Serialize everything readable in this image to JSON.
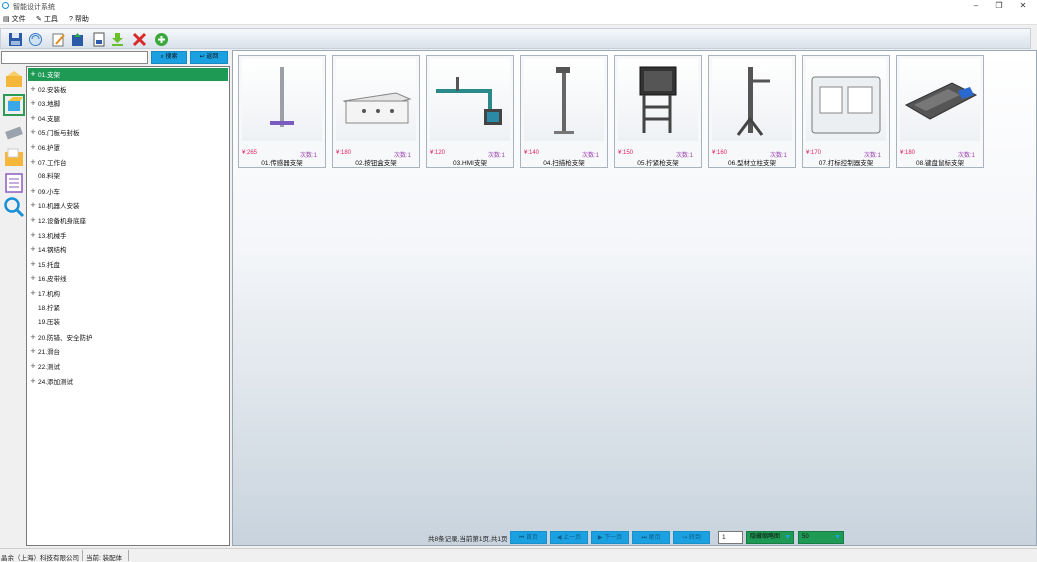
{
  "window": {
    "title": "智能设计系统",
    "minimize": "–",
    "restore": "❐",
    "close": "✕"
  },
  "menu": [
    {
      "label": "文件",
      "icon": "file-icon"
    },
    {
      "label": "工具",
      "icon": "wrench-icon"
    },
    {
      "label": "帮助",
      "icon": "help-icon"
    }
  ],
  "toolbar": [
    "save-icon",
    "sync-icon",
    "edit-icon",
    "upload-icon",
    "document-icon",
    "download-icon",
    "delete-icon",
    "add-icon"
  ],
  "search": {
    "placeholder": "",
    "search_label": "搜索",
    "back_label": "返回"
  },
  "tree": [
    {
      "label": "01.支架",
      "expandable": true,
      "selected": true
    },
    {
      "label": "02.安装板",
      "expandable": true
    },
    {
      "label": "03.地脚",
      "expandable": true
    },
    {
      "label": "04.支腿",
      "expandable": true
    },
    {
      "label": "05.门板与封板",
      "expandable": true
    },
    {
      "label": "06.护罩",
      "expandable": true
    },
    {
      "label": "07.工作台",
      "expandable": true
    },
    {
      "label": "08.料架",
      "expandable": false
    },
    {
      "label": "09.小车",
      "expandable": true
    },
    {
      "label": "10.机器人安装",
      "expandable": true
    },
    {
      "label": "12.设备机身底座",
      "expandable": true
    },
    {
      "label": "13.机械手",
      "expandable": true
    },
    {
      "label": "14.钢结构",
      "expandable": true
    },
    {
      "label": "15.托盘",
      "expandable": true
    },
    {
      "label": "16.皮带线",
      "expandable": true
    },
    {
      "label": "17.机构",
      "expandable": true
    },
    {
      "label": "18.拧紧",
      "expandable": false
    },
    {
      "label": "19.压装",
      "expandable": false
    },
    {
      "label": "20.防错、安全防护",
      "expandable": true
    },
    {
      "label": "21.滑台",
      "expandable": true
    },
    {
      "label": "22.测试",
      "expandable": true
    },
    {
      "label": "24.添加测试",
      "expandable": true
    }
  ],
  "cards": [
    {
      "price": "¥:265",
      "count": "次数:1",
      "name": "01.传感器支架",
      "kind": "sensor-bracket"
    },
    {
      "price": "¥:180",
      "count": "次数:1",
      "name": "02.按钮盒支架",
      "kind": "button-box"
    },
    {
      "price": "¥:120",
      "count": "次数:1",
      "name": "03.HMI支架",
      "kind": "hmi"
    },
    {
      "price": "¥:140",
      "count": "次数:1",
      "name": "04.扫描枪支架",
      "kind": "scanner"
    },
    {
      "price": "¥:150",
      "count": "次数:1",
      "name": "05.拧紧枪支架",
      "kind": "tightening"
    },
    {
      "price": "¥:160",
      "count": "次数:1",
      "name": "06.型材立柱支架",
      "kind": "profile-column"
    },
    {
      "price": "¥:170",
      "count": "次数:1",
      "name": "07.打标控制器支架",
      "kind": "marking"
    },
    {
      "price": "¥:180",
      "count": "次数:1",
      "name": "08.键盘鼠标支架",
      "kind": "keyboard"
    }
  ],
  "pager": {
    "info": "共8条记录,当前第1页,共1页",
    "first": "首页",
    "prev": "上一页",
    "next": "下一页",
    "last": "尾页",
    "go": "转到",
    "page_value": "1",
    "view_mode": "隐藏缩略图",
    "page_size": "50"
  },
  "status": {
    "company": "晶余（上海）科技有限公司",
    "current": "当前: 装配体"
  }
}
